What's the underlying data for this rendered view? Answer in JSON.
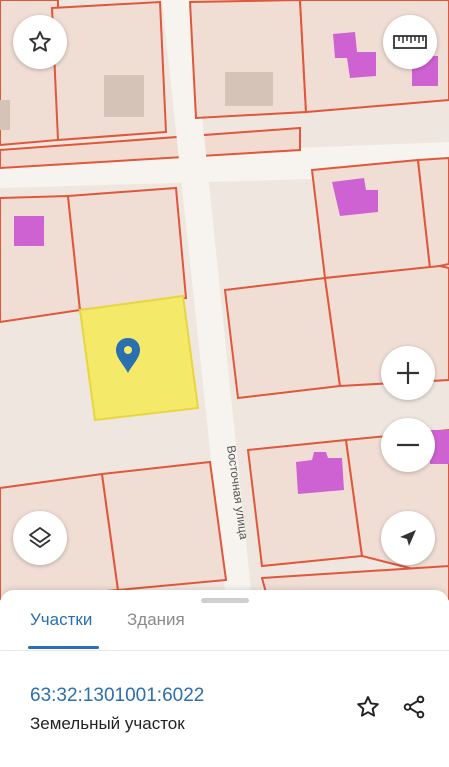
{
  "map": {
    "street_label": "Восточная улица",
    "colors": {
      "background": "#efe7df",
      "parcel_fill": "#f0ddd4",
      "parcel_border": "#e0573b",
      "road": "#f7f3ef",
      "building": "#cf62d3",
      "building_gray": "#d6c3b8",
      "selected_parcel": "#f5e96a",
      "selected_border": "#e7d63e",
      "pin": "#2a6fb0"
    }
  },
  "controls": {
    "favorite": "star-icon",
    "measure": "ruler-icon",
    "zoom_in": "plus-icon",
    "zoom_out": "minus-icon",
    "layers": "layers-icon",
    "locate": "navigation-arrow-icon"
  },
  "sheet": {
    "tabs": [
      {
        "label": "Участки",
        "active": true
      },
      {
        "label": "Здания",
        "active": false
      }
    ],
    "parcel": {
      "cadastral_number": "63:32:1301001:6022",
      "type": "Земельный участок"
    }
  }
}
